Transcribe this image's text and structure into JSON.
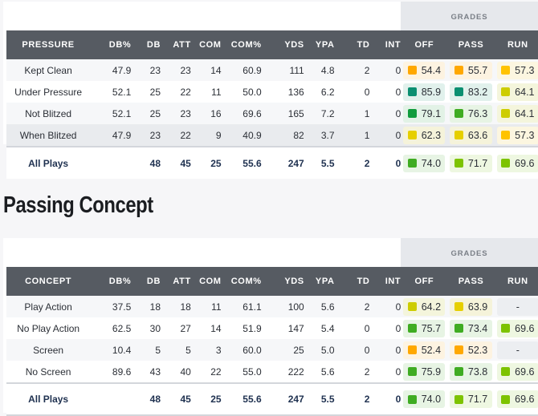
{
  "grades_header": "GRADES",
  "columns": [
    "DB%",
    "DB",
    "ATT",
    "COM",
    "COM%",
    "YDS",
    "YPA",
    "TD",
    "INT",
    "OFF",
    "PASS",
    "RUN"
  ],
  "grade_colors": {
    "orange": {
      "swatch": "#ffa800",
      "bg": "#fdf3e1"
    },
    "amber": {
      "swatch": "#ffc300",
      "bg": "#fcf6e0"
    },
    "yellow": {
      "swatch": "#e6cf00",
      "bg": "#f5f3da"
    },
    "olive": {
      "swatch": "#cdcd00",
      "bg": "#f4f5dc"
    },
    "lime": {
      "swatch": "#7dc300",
      "bg": "#eef7e1"
    },
    "green": {
      "swatch": "#3fac22",
      "bg": "#e7f4e4"
    },
    "dkgreen": {
      "swatch": "#109c3c",
      "bg": "#e2f2e6"
    },
    "teal": {
      "swatch": "#0b8f71",
      "bg": "#e1f1ec"
    },
    "none": {
      "swatch": "",
      "bg": "#eceef1"
    }
  },
  "pressure": {
    "label_header": "PRESSURE",
    "rows": [
      {
        "label": "Kept Clean",
        "dbp": "47.9",
        "db": "23",
        "att": "23",
        "com": "14",
        "comp": "60.9",
        "yds": "111",
        "ypa": "4.8",
        "td": "2",
        "int": "0",
        "off": {
          "v": "54.4",
          "c": "orange"
        },
        "pass": {
          "v": "55.7",
          "c": "orange"
        },
        "run": {
          "v": "57.3",
          "c": "amber"
        }
      },
      {
        "label": "Under Pressure",
        "dbp": "52.1",
        "db": "25",
        "att": "22",
        "com": "11",
        "comp": "50.0",
        "yds": "136",
        "ypa": "6.2",
        "td": "0",
        "int": "0",
        "off": {
          "v": "85.9",
          "c": "teal"
        },
        "pass": {
          "v": "83.2",
          "c": "teal"
        },
        "run": {
          "v": "64.1",
          "c": "olive"
        }
      },
      {
        "label": "Not Blitzed",
        "dbp": "52.1",
        "db": "25",
        "att": "23",
        "com": "16",
        "comp": "69.6",
        "yds": "165",
        "ypa": "7.2",
        "td": "1",
        "int": "0",
        "off": {
          "v": "79.1",
          "c": "dkgreen"
        },
        "pass": {
          "v": "76.3",
          "c": "green"
        },
        "run": {
          "v": "64.1",
          "c": "olive"
        }
      },
      {
        "label": "When Blitzed",
        "dbp": "47.9",
        "db": "23",
        "att": "22",
        "com": "9",
        "comp": "40.9",
        "yds": "82",
        "ypa": "3.7",
        "td": "1",
        "int": "0",
        "off": {
          "v": "62.3",
          "c": "yellow"
        },
        "pass": {
          "v": "63.6",
          "c": "yellow"
        },
        "run": {
          "v": "57.3",
          "c": "amber"
        }
      }
    ],
    "total": {
      "label": "All Plays",
      "dbp": "",
      "db": "48",
      "att": "45",
      "com": "25",
      "comp": "55.6",
      "yds": "247",
      "ypa": "5.5",
      "td": "2",
      "int": "0",
      "off": {
        "v": "74.0",
        "c": "green"
      },
      "pass": {
        "v": "71.7",
        "c": "lime"
      },
      "run": {
        "v": "69.6",
        "c": "lime"
      }
    }
  },
  "section_title": "Passing Concept",
  "concept": {
    "label_header": "CONCEPT",
    "rows": [
      {
        "label": "Play Action",
        "dbp": "37.5",
        "db": "18",
        "att": "18",
        "com": "11",
        "comp": "61.1",
        "yds": "100",
        "ypa": "5.6",
        "td": "2",
        "int": "0",
        "off": {
          "v": "64.2",
          "c": "olive"
        },
        "pass": {
          "v": "63.9",
          "c": "yellow"
        },
        "run": {
          "v": "-",
          "c": "none"
        }
      },
      {
        "label": "No Play Action",
        "dbp": "62.5",
        "db": "30",
        "att": "27",
        "com": "14",
        "comp": "51.9",
        "yds": "147",
        "ypa": "5.4",
        "td": "0",
        "int": "0",
        "off": {
          "v": "75.7",
          "c": "green"
        },
        "pass": {
          "v": "73.4",
          "c": "green"
        },
        "run": {
          "v": "69.6",
          "c": "lime"
        }
      },
      {
        "label": "Screen",
        "dbp": "10.4",
        "db": "5",
        "att": "5",
        "com": "3",
        "comp": "60.0",
        "yds": "25",
        "ypa": "5.0",
        "td": "0",
        "int": "0",
        "off": {
          "v": "52.4",
          "c": "orange"
        },
        "pass": {
          "v": "52.3",
          "c": "orange"
        },
        "run": {
          "v": "-",
          "c": "none"
        }
      },
      {
        "label": "No Screen",
        "dbp": "89.6",
        "db": "43",
        "att": "40",
        "com": "22",
        "comp": "55.0",
        "yds": "222",
        "ypa": "5.6",
        "td": "2",
        "int": "0",
        "off": {
          "v": "75.9",
          "c": "green"
        },
        "pass": {
          "v": "73.8",
          "c": "green"
        },
        "run": {
          "v": "69.6",
          "c": "lime"
        }
      }
    ],
    "total": {
      "label": "All Plays",
      "dbp": "",
      "db": "48",
      "att": "45",
      "com": "25",
      "comp": "55.6",
      "yds": "247",
      "ypa": "5.5",
      "td": "2",
      "int": "0",
      "off": {
        "v": "74.0",
        "c": "green"
      },
      "pass": {
        "v": "71.7",
        "c": "lime"
      },
      "run": {
        "v": "69.6",
        "c": "lime"
      }
    }
  }
}
